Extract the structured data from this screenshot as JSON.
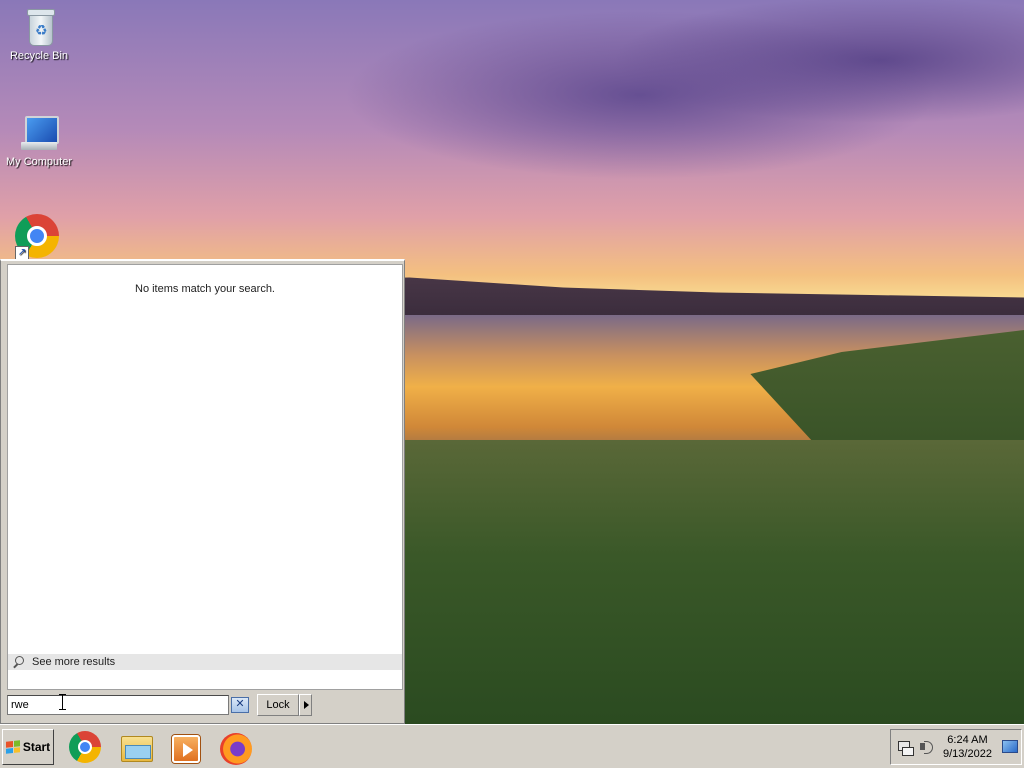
{
  "desktop": {
    "icons": [
      {
        "label": "Recycle Bin",
        "icon": "recycle-bin-icon"
      },
      {
        "label": "My Computer",
        "icon": "computer-icon"
      },
      {
        "label": "",
        "icon": "chrome-icon"
      }
    ]
  },
  "start_panel": {
    "no_results_text": "No items match your search.",
    "see_more_label": "See more results",
    "search_value": "rwe",
    "clear_icon": "clear-search-icon",
    "lock_label": "Lock",
    "lock_arrow_icon": "chevron-right-icon"
  },
  "taskbar": {
    "start_label": "Start",
    "pinned_apps": [
      "chrome-icon",
      "file-explorer-icon",
      "media-player-icon",
      "firefox-icon"
    ],
    "clock_time": "6:24 AM",
    "clock_date": "9/13/2022",
    "tray_icons": [
      "network-icon",
      "volume-icon",
      "show-desktop-icon"
    ]
  }
}
